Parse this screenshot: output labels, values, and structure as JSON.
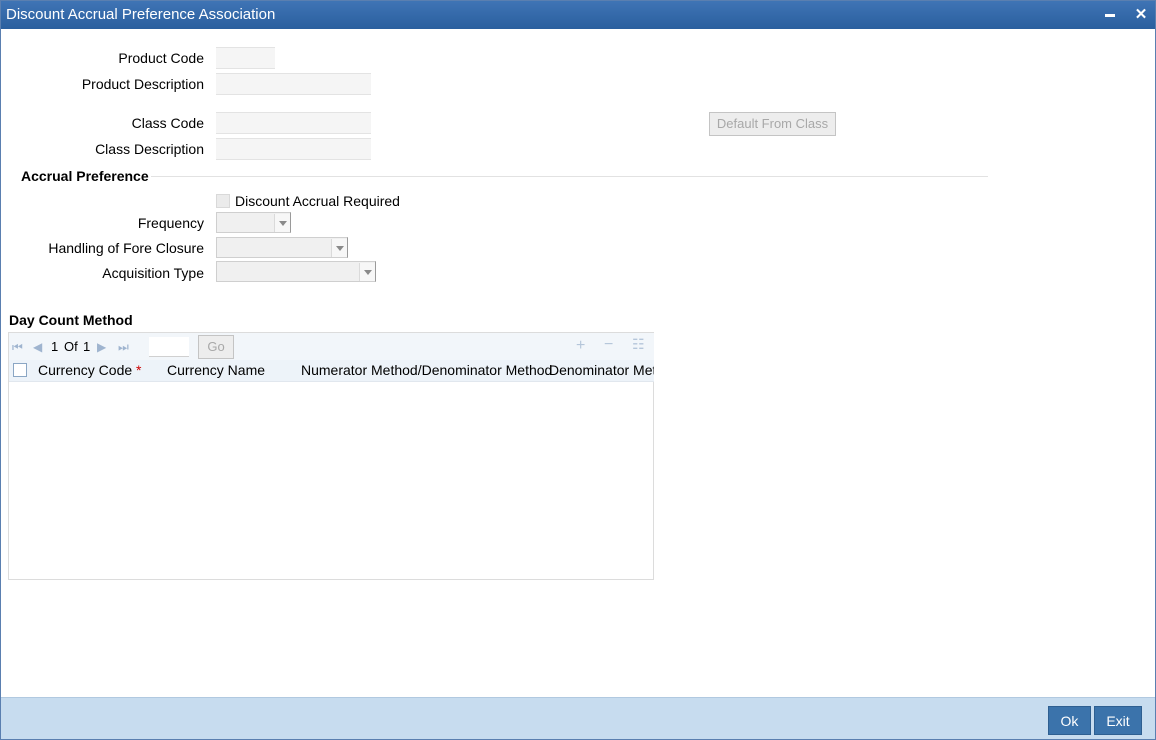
{
  "window": {
    "title": "Discount Accrual Preference Association",
    "minimize_glyph": "▬",
    "close_glyph": "✕"
  },
  "form": {
    "product_code_label": "Product Code",
    "product_code_value": "",
    "product_description_label": "Product Description",
    "product_description_value": "",
    "class_code_label": "Class Code",
    "class_code_value": "",
    "class_description_label": "Class Description",
    "class_description_value": "",
    "default_from_class_button": "Default From Class"
  },
  "accrual_preference": {
    "section_title": "Accrual Preference",
    "discount_accrual_required_label": "Discount Accrual Required",
    "discount_accrual_required_checked": false,
    "frequency_label": "Frequency",
    "frequency_value": "",
    "handling_fore_closure_label": "Handling of Fore Closure",
    "handling_fore_closure_value": "",
    "acquisition_type_label": "Acquisition Type",
    "acquisition_type_value": ""
  },
  "day_count": {
    "section_title": "Day Count Method",
    "pagination": {
      "current": "1",
      "of_label": "Of",
      "total": "1",
      "go_button": "Go"
    },
    "toolbar_icons": [
      "first-page-icon",
      "prev-page-icon",
      "next-page-icon",
      "last-page-icon",
      "add-row-icon",
      "delete-row-icon",
      "single-view-icon"
    ],
    "columns": [
      {
        "label": "Currency Code",
        "required_marker": "*"
      },
      {
        "label": "Currency Name"
      },
      {
        "label": "Numerator Method/Denominator Method"
      },
      {
        "label": "Denominator Meth"
      }
    ],
    "rows": []
  },
  "footer": {
    "ok_button": "Ok",
    "exit_button": "Exit"
  },
  "colors": {
    "titlebar": "#2f67a8",
    "footer": "#c7dcef",
    "primary_button": "#3b73ab",
    "required": "#cc0000"
  }
}
